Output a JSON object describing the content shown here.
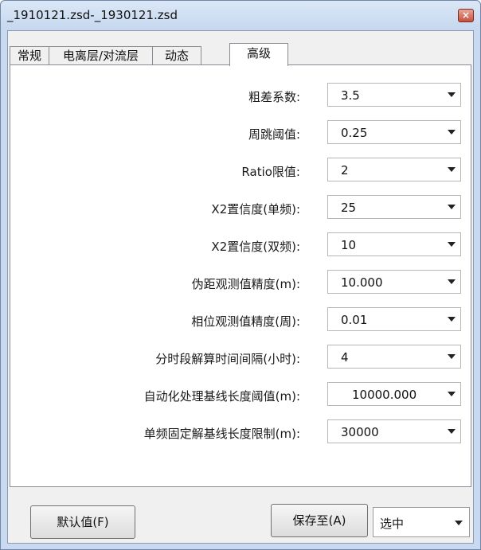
{
  "window": {
    "title": "_1910121.zsd-_1930121.zsd",
    "close_glyph": "×"
  },
  "tabs": [
    {
      "label": "常规"
    },
    {
      "label": "电离层/对流层"
    },
    {
      "label": "动态"
    },
    {
      "label": "高级"
    }
  ],
  "active_tab": "高级",
  "settings": [
    {
      "label": "粗差系数:",
      "value": "3.5"
    },
    {
      "label": "周跳阈值:",
      "value": "0.25"
    },
    {
      "label": "Ratio限值:",
      "value": "2"
    },
    {
      "label": "X2置信度(单频):",
      "value": "25"
    },
    {
      "label": "X2置信度(双频):",
      "value": "10"
    },
    {
      "label": "伪距观测值精度(m):",
      "value": "10.000"
    },
    {
      "label": "相位观测值精度(周):",
      "value": "0.01"
    },
    {
      "label": "分时段解算时间间隔(小时):",
      "value": "4"
    },
    {
      "label": "自动化处理基线长度阈值(m):",
      "value": "10000.000"
    },
    {
      "label": "单频固定解基线长度限制(m):",
      "value": "30000"
    }
  ],
  "footer": {
    "default_button": "默认值(F)",
    "save_button": "保存至(A)",
    "scope_select": "选中"
  },
  "colors": {
    "title_bar": "#c9daf0",
    "close_button": "#c8503c"
  }
}
